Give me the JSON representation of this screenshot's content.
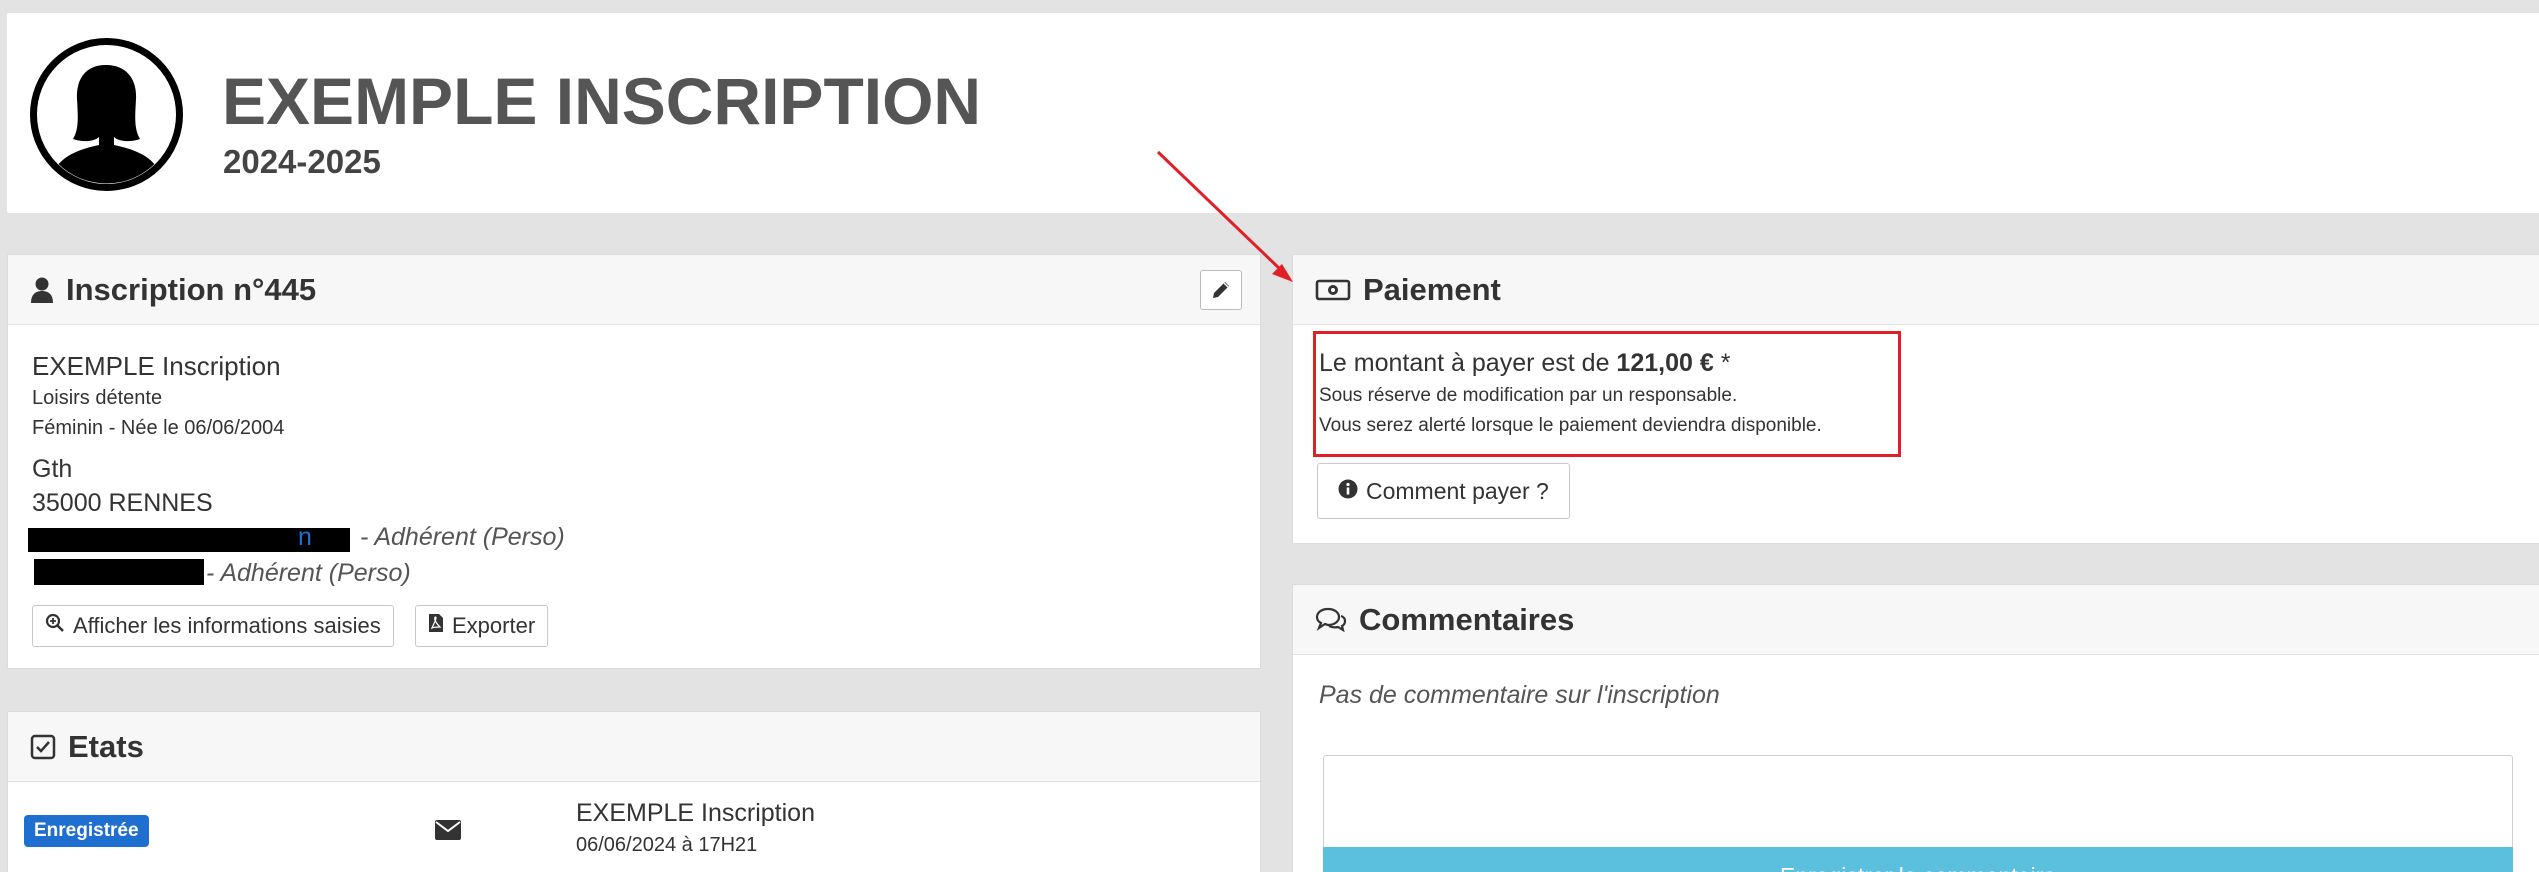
{
  "header": {
    "title": "EXEMPLE INSCRIPTION",
    "season": "2024-2025"
  },
  "inscription": {
    "title": "Inscription n°445",
    "name": "EXEMPLE Inscription",
    "activity": "Loisirs détente",
    "gender_birth": "Féminin - Née le 06/06/2004",
    "address_line1": "Gth",
    "address_line2": "35000 RENNES",
    "member1_suffix": "n",
    "member1_role": "- Adhérent (Perso)",
    "member2_role": "- Adhérent (Perso)",
    "show_info_label": "Afficher les informations saisies",
    "export_label": "Exporter"
  },
  "etats": {
    "title": "Etats",
    "status": "Enregistrée",
    "author": "EXEMPLE Inscription",
    "date": "06/06/2024 à 17H21"
  },
  "paiement": {
    "title": "Paiement",
    "amount_prefix": "Le montant à payer est de",
    "amount": "121,00 €",
    "amount_suffix": "*",
    "note1": "Sous réserve de modification par un responsable.",
    "note2": "Vous serez alerté lorsque le paiement deviendra disponible.",
    "how_to_pay_label": "Comment payer ?"
  },
  "commentaires": {
    "title": "Commentaires",
    "empty_text": "Pas de commentaire sur l'inscription",
    "save_label": "Enregistrer le commentaire"
  },
  "colors": {
    "badge": "#1f6fd1",
    "highlight_box": "#e01f26",
    "save_button": "#5bc0de"
  },
  "icons": [
    "user-icon",
    "pencil-icon",
    "zoom-in-icon",
    "pdf-icon",
    "checkbox-icon",
    "envelope-icon",
    "money-icon",
    "info-icon",
    "comments-icon"
  ]
}
